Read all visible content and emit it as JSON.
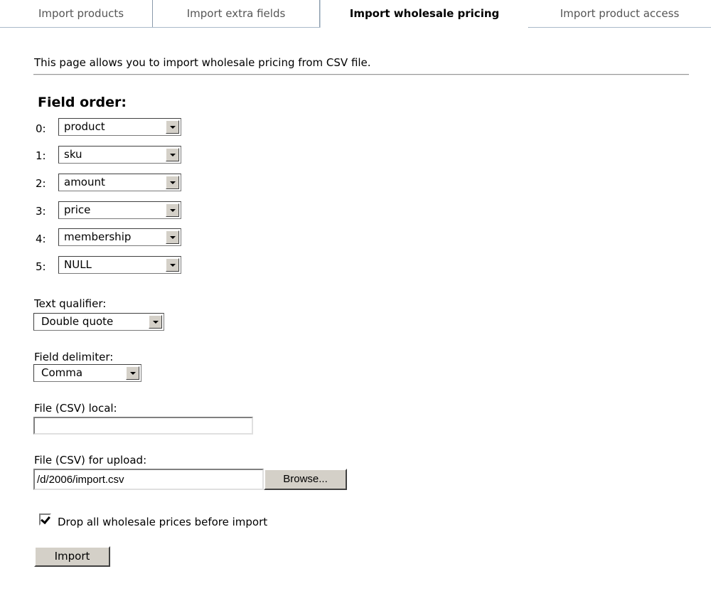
{
  "tabs": [
    {
      "label": "Import products"
    },
    {
      "label": "Import extra fields"
    },
    {
      "label": "Import wholesale pricing",
      "active": true
    },
    {
      "label": "Import product access"
    }
  ],
  "intro": "This page allows you to import wholesale pricing from CSV file.",
  "field_order": {
    "title": "Field order:",
    "rows": [
      {
        "index": "0:",
        "value": "product"
      },
      {
        "index": "1:",
        "value": "sku"
      },
      {
        "index": "2:",
        "value": "amount"
      },
      {
        "index": "3:",
        "value": "price"
      },
      {
        "index": "4:",
        "value": "membership"
      },
      {
        "index": "5:",
        "value": "NULL"
      }
    ]
  },
  "text_qualifier": {
    "label": "Text qualifier:",
    "value": "Double quote"
  },
  "field_delimiter": {
    "label": "Field delimiter:",
    "value": "Comma"
  },
  "file_local": {
    "label": "File (CSV) local:",
    "value": ""
  },
  "file_upload": {
    "label": "File (CSV) for upload:",
    "value": "/d/2006/import.csv",
    "browse": "Browse..."
  },
  "drop_prices": {
    "label": "Drop all wholesale prices before import",
    "checked": true
  },
  "import_button": "Import",
  "colors": {
    "tab_border": "#a9b9c9",
    "button_face": "#d4d0c8"
  }
}
